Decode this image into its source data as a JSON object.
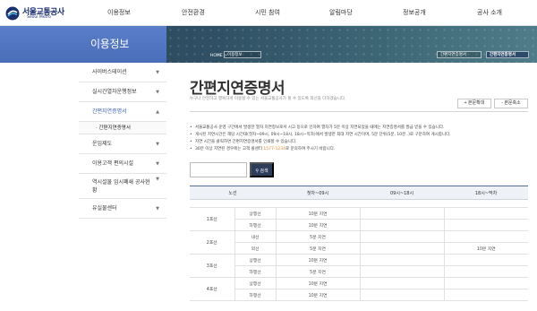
{
  "header": {
    "logo_ko": "서울교통공사",
    "logo_en": "Seoul Metro",
    "gnb": [
      "이용정보",
      "안전환경",
      "시민 참여",
      "알림마당",
      "정보공개",
      "공사 소개"
    ]
  },
  "banner": {
    "side_title": "이용정보",
    "breadcrumb_home": "HOME >",
    "select1": "이용정보",
    "select2": "간편지연증명서",
    "select3": "간편지연증명서"
  },
  "sidebar": {
    "items": [
      {
        "label": "사이버스테이션"
      },
      {
        "label": "실시간열차운행정보"
      },
      {
        "label": "간편지연증명서"
      },
      {
        "label": "운임제도"
      },
      {
        "label": "이용고객 편의시설"
      },
      {
        "label": "역시설물 임시폐쇄 공사현황"
      },
      {
        "label": "유실물센터"
      }
    ],
    "subitem": "간편지연증명서"
  },
  "content": {
    "title": "간편지연증명서",
    "description": "누구나 안전하고 행복하게 이용할 수 있는 서울교통공사가 될 수 있도록 최선을 다하겠습니다.",
    "zoom_in": "+ 본문확대",
    "zoom_out": "- 본문축소",
    "bullets": [
      "서울교통공사 운영 구간에서 발생한 열차 지연정보로서 시고 등으로 인하여 열차가 5분 이상 지연되었을 때에는 지연증명서를 발급 받을 수 있습니다.",
      "게시된 지연시간은 해당 시간대(첫차~09시, 09시~18시, 18시~막차)에서 발생한 최대 지연 시간이며, 5분 단위(5분, 10분..)로 구분하여 게시합니다.",
      "지연 시간을 클릭하면 간편지연증명서를 인쇄할 수 있습니다."
    ],
    "bullet4_pre": "30분 이상 지연된 경우에는 고객 콜센터 ",
    "bullet4_phone": "1577-1234",
    "bullet4_post": "로 문의하여 주시기 바랍니다.",
    "search_button": "검색"
  },
  "table": {
    "headers": [
      "노선",
      "",
      "첫차~09시",
      "09시~18시",
      "18시~막차"
    ],
    "rows": [
      {
        "line": "1호선",
        "dir": "상행선",
        "c1": "10분 지연",
        "c2": "",
        "c3": ""
      },
      {
        "line": "",
        "dir": "하행선",
        "c1": "10분 지연",
        "c2": "",
        "c3": ""
      },
      {
        "line": "2호선",
        "dir": "내선",
        "c1": "5분 지연",
        "c2": "",
        "c3": ""
      },
      {
        "line": "",
        "dir": "외선",
        "c1": "5분 지연",
        "c2": "",
        "c3": "10분 지연"
      },
      {
        "line": "3호선",
        "dir": "상행선",
        "c1": "10분 지연",
        "c2": "",
        "c3": ""
      },
      {
        "line": "",
        "dir": "하행선",
        "c1": "5분 지연",
        "c2": "",
        "c3": ""
      },
      {
        "line": "4호선",
        "dir": "상행선",
        "c1": "10분 지연",
        "c2": "",
        "c3": ""
      },
      {
        "line": "",
        "dir": "하행선",
        "c1": "10분 지연",
        "c2": "",
        "c3": ""
      }
    ]
  },
  "colors": {
    "banner_side": "#4a6eb8",
    "accent_blue": "#3a62b5",
    "search_button": "#2e3d5a",
    "phone_highlight": "#e08a2c"
  }
}
